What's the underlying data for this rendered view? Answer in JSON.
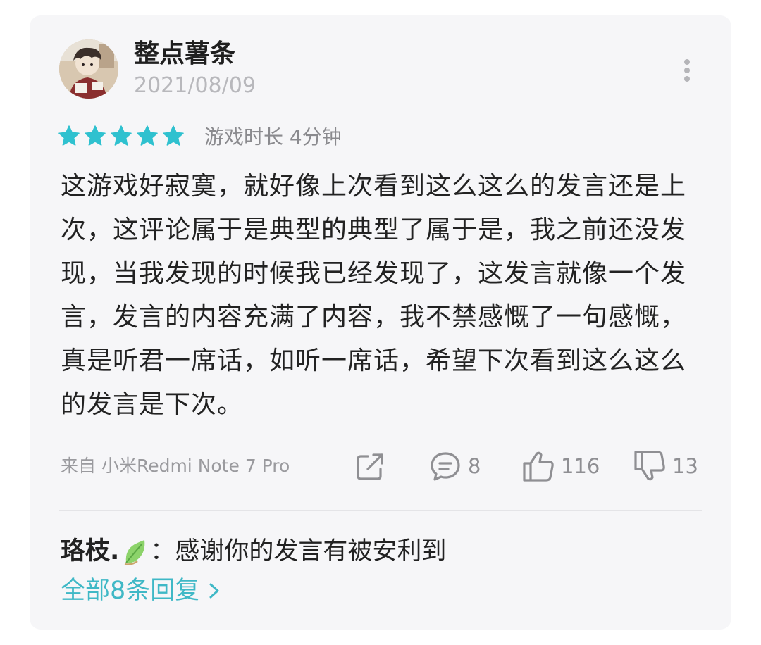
{
  "review": {
    "username": "整点薯条",
    "date": "2021/08/09",
    "rating": 5,
    "max_rating": 5,
    "playtime": "游戏时长 4分钟",
    "content": "这游戏好寂寞，就好像上次看到这么这么的发言还是上次，这评论属于是典型的典型了属于是，我之前还没发现，当我发现的时候我已经发现了，这发言就像一个发言，发言的内容充满了内容，我不禁感慨了一句感慨，真是听君一席话，如听一席话，希望下次看到这么这么的发言是下次。",
    "device": "来自 小米Redmi Note 7 Pro"
  },
  "actions": {
    "share_icon": "share-icon",
    "comment_count": "8",
    "like_count": "116",
    "dislike_count": "13"
  },
  "reply": {
    "author": "珞枝.",
    "badge_icon": "leaf-icon",
    "separator": "：",
    "text": "感谢你的发言有被安利到"
  },
  "view_all_replies": "全部8条回复",
  "colors": {
    "accent": "#3fb8c6",
    "star": "#2fc1cf",
    "card_bg": "#f6f6f8",
    "muted": "#9a9a9e"
  }
}
